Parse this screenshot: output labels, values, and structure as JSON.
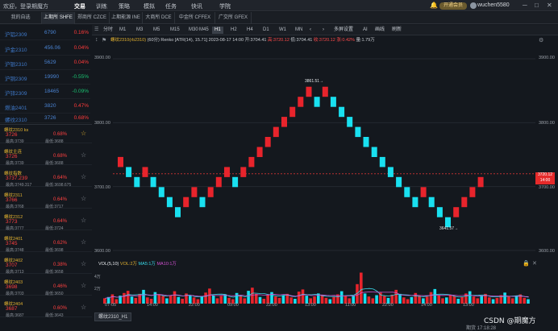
{
  "topbar": {
    "welcome": "欢迎，登录期魔方",
    "nav": [
      "交易",
      "训练",
      "策略",
      "模拟",
      "任务",
      "快讯",
      "学院"
    ],
    "vip_label": "开通会员",
    "username": "wuchen5580"
  },
  "exchange_tabs": [
    "我的自选",
    "上期所 SHFE",
    "郑商所 CZCE",
    "上期能源 INE",
    "大商所 DCE",
    "中金所 CFFEX",
    "广交所 GFEX"
  ],
  "watchlist": [
    {
      "name": "沪铝2309",
      "price": "6790",
      "pct": "0.16%",
      "dir": "up"
    },
    {
      "name": "沪金2310",
      "price": "456.06",
      "pct": "0.04%",
      "dir": "up"
    },
    {
      "name": "沪银2310",
      "price": "5629",
      "pct": "0.04%",
      "dir": "up"
    },
    {
      "name": "沪铜2309",
      "price": "19990",
      "pct": "-0.55%",
      "dir": "down"
    },
    {
      "name": "沪锌2309",
      "price": "18465",
      "pct": "-0.09%",
      "dir": "down"
    },
    {
      "name": "燃油2401",
      "price": "3820",
      "pct": "0.47%",
      "dir": "up"
    },
    {
      "name": "螺纹2310",
      "price": "3726",
      "pct": "0.68%",
      "dir": "up"
    }
  ],
  "contracts": [
    {
      "name": "螺纹2310 ks",
      "price": "3726",
      "pct": "0.68%",
      "high": "最高:3739",
      "low": "最低:3688",
      "fav": true
    },
    {
      "name": "螺纹主连",
      "price": "3726",
      "pct": "0.68%",
      "high": "最高:3739",
      "low": "最低:3688",
      "fav": false
    },
    {
      "name": "螺纹指数",
      "price": "3737.239",
      "pct": "0.64%",
      "high": "最高:3749.317",
      "low": "最低:3698.675",
      "fav": false
    },
    {
      "name": "螺纹2311",
      "price": "3766",
      "pct": "0.64%",
      "high": "最高:3768",
      "low": "最低:3717",
      "fav": false
    },
    {
      "name": "螺纹2312",
      "price": "3773",
      "pct": "0.64%",
      "high": "最高:3777",
      "low": "最低:3724",
      "fav": false
    },
    {
      "name": "螺纹2401",
      "price": "3745",
      "pct": "0.62%",
      "high": "最高:3748",
      "low": "最低:3698",
      "fav": false
    },
    {
      "name": "螺纹2402",
      "price": "3707",
      "pct": "0.38%",
      "high": "最高:3713",
      "low": "最低:3658",
      "fav": false
    },
    {
      "name": "螺纹2403",
      "price": "3698",
      "pct": "0.46%",
      "high": "最高:3703",
      "low": "最低:3650",
      "fav": false
    },
    {
      "name": "螺纹2404",
      "price": "3687",
      "pct": "0.60%",
      "high": "最高:3687",
      "low": "最低:3643",
      "fav": false
    }
  ],
  "chart_toolbar": {
    "timeframes": [
      "分时",
      "M1",
      "M3",
      "M5",
      "M15",
      "M30",
      "M45",
      "H1",
      "H2",
      "H4",
      "D1",
      "W1",
      "MN"
    ],
    "active_timeframe": "H1",
    "tools": [
      "多屏设置",
      "AI",
      "画线",
      "刷新"
    ]
  },
  "chart_info": {
    "symbol": "螺纹2310(rb2310)",
    "meta": "(60分) Renko [ATR(14), 15.71]  2023-08-17  14:00  开:3704.41",
    "high": "高:3720.12",
    "low": "低:3704.41",
    "close": "收:3720.12",
    "change": "涨:0.42%",
    "volume": "量:1.79万"
  },
  "chart_data": {
    "type": "renko",
    "brick_size": 15.71,
    "ylim": [
      3600,
      3900
    ],
    "yticks": [
      "3900.00",
      "3800.00",
      "3700.00",
      "3600.00"
    ],
    "xticks": [
      "07-05",
      "14:00",
      "22:00",
      "09:00",
      "22:00",
      "13:00",
      "11:00",
      "22:00",
      "14:00",
      "22:00",
      "13:00"
    ],
    "bricks": [
      {
        "dir": "up",
        "low": 3730.6
      },
      {
        "dir": "down",
        "low": 3714.9
      },
      {
        "dir": "down",
        "low": 3699.2
      },
      {
        "dir": "up",
        "low": 3714.9
      },
      {
        "dir": "down",
        "low": 3699.2
      },
      {
        "dir": "down",
        "low": 3683.5
      },
      {
        "dir": "down",
        "low": 3667.8
      },
      {
        "dir": "down",
        "low": 3652.1
      },
      {
        "dir": "up",
        "low": 3667.8
      },
      {
        "dir": "up",
        "low": 3683.5
      },
      {
        "dir": "down",
        "low": 3667.8
      },
      {
        "dir": "up",
        "low": 3683.5
      },
      {
        "dir": "up",
        "low": 3699.2
      },
      {
        "dir": "up",
        "low": 3714.9
      },
      {
        "dir": "down",
        "low": 3699.2
      },
      {
        "dir": "up",
        "low": 3714.9
      },
      {
        "dir": "up",
        "low": 3730.6
      },
      {
        "dir": "up",
        "low": 3746.3
      },
      {
        "dir": "up",
        "low": 3762.0
      },
      {
        "dir": "up",
        "low": 3777.7
      },
      {
        "dir": "up",
        "low": 3793.4
      },
      {
        "dir": "up",
        "low": 3809.1
      },
      {
        "dir": "up",
        "low": 3824.8
      },
      {
        "dir": "up",
        "low": 3840.5
      },
      {
        "dir": "down",
        "low": 3824.8
      },
      {
        "dir": "up",
        "low": 3840.5
      },
      {
        "dir": "down",
        "low": 3824.8
      },
      {
        "dir": "down",
        "low": 3809.1
      },
      {
        "dir": "down",
        "low": 3793.4
      },
      {
        "dir": "down",
        "low": 3777.7
      },
      {
        "dir": "down",
        "low": 3762.0
      },
      {
        "dir": "down",
        "low": 3746.3
      },
      {
        "dir": "down",
        "low": 3730.6
      },
      {
        "dir": "down",
        "low": 3714.9
      },
      {
        "dir": "down",
        "low": 3699.2
      },
      {
        "dir": "down",
        "low": 3683.5
      },
      {
        "dir": "down",
        "low": 3667.8
      },
      {
        "dir": "up",
        "low": 3683.5
      },
      {
        "dir": "down",
        "low": 3667.8
      },
      {
        "dir": "down",
        "low": 3652.1
      },
      {
        "dir": "down",
        "low": 3636.4
      },
      {
        "dir": "up",
        "low": 3652.1
      },
      {
        "dir": "up",
        "low": 3667.8
      },
      {
        "dir": "up",
        "low": 3683.5
      },
      {
        "dir": "up",
        "low": 3699.2
      }
    ],
    "annotations": [
      {
        "text": "3861.51→",
        "at_brick": 23
      },
      {
        "text": "3641.57→",
        "at_brick": 40
      }
    ],
    "last_price_tag": "3720.12",
    "last_price_sub": "14:00",
    "last_price": 3720.12
  },
  "volume": {
    "label": "VOL(5,10)",
    "vol_text": "VOL:2万",
    "ma5": "MA5:1万",
    "ma10": "MA10:1万",
    "yticks": [
      "4万",
      "2万"
    ],
    "ylim": [
      0,
      8
    ],
    "bars": [
      1.2,
      1.5,
      2.1,
      1.0,
      1.8,
      2.4,
      2.9,
      1.6,
      1.3,
      2.2,
      3.1,
      1.4,
      1.1,
      2.6,
      2.0,
      1.7,
      1.2,
      1.9,
      2.8,
      1.5,
      1.1,
      2.3,
      1.8,
      1.4,
      1.0,
      1.6,
      2.5,
      3.4,
      1.9,
      1.2,
      1.7,
      2.1,
      1.3,
      1.0,
      2.4,
      1.8,
      1.2,
      2.9,
      3.6,
      2.2,
      1.5,
      1.1,
      2.0,
      2.6,
      1.6,
      1.3,
      1.9,
      2.2,
      1.4,
      1.1,
      2.7,
      3.2,
      1.8,
      1.2,
      1.6,
      2.3,
      1.9,
      1.3,
      1.0,
      1.5,
      2.1,
      2.8,
      1.7,
      1.2,
      1.8,
      4.4,
      7.0,
      2.3,
      1.6,
      1.2,
      1.9,
      2.5,
      1.7,
      1.3,
      2.0,
      3.1,
      2.2,
      1.4,
      1.0,
      1.5,
      2.4,
      1.8,
      1.2,
      1.6,
      2.6,
      3.3,
      1.9,
      1.2,
      1.4,
      2.0,
      1.7,
      1.1,
      1.5,
      2.3,
      2.8,
      1.6,
      1.2,
      1.8,
      2.2,
      1.4,
      1.0,
      1.3,
      1.9,
      2.5,
      1.6,
      1.2,
      1.7,
      2.1,
      1.3,
      1.0
    ]
  },
  "bottom": {
    "tab": "螺纹2310_H1",
    "clock": "期货 17:18:28",
    "watermark": "CSDN @期魔方"
  },
  "colors": {
    "up": "#e8242c",
    "down": "#19e0f0",
    "bg": "#14181e"
  }
}
